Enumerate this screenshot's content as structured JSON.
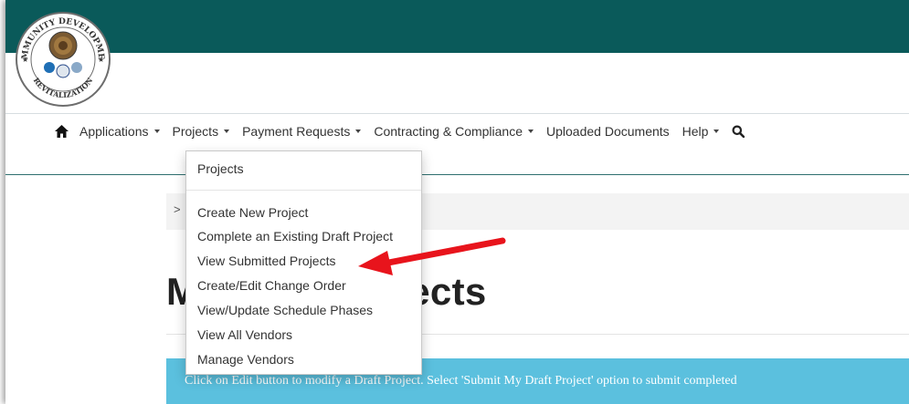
{
  "logo": {
    "ring_text_top": "COMMUNITY DEVELOPMENT",
    "ring_text_bottom": "REVITALIZATION",
    "colors": {
      "band": "#0a5a5a",
      "ring": "#6d6d6d",
      "seal": "#7a5a32"
    }
  },
  "nav": {
    "home_icon": "home-icon",
    "items": [
      {
        "label": "Applications",
        "has_caret": true
      },
      {
        "label": "Projects",
        "has_caret": true
      },
      {
        "label": "Payment Requests",
        "has_caret": true
      },
      {
        "label": "Contracting & Compliance",
        "has_caret": true
      },
      {
        "label": "Uploaded Documents",
        "has_caret": false
      },
      {
        "label": "Help",
        "has_caret": true
      }
    ],
    "search_icon": "search-icon"
  },
  "breadcrumb": {
    "char": ">"
  },
  "dropdown": {
    "header": "Projects",
    "items": [
      "Create New Project",
      "Complete an Existing Draft Project",
      "View Submitted Projects",
      "Create/Edit Change Order",
      "View/Update Schedule Phases",
      "View All Vendors",
      "Manage Vendors"
    ]
  },
  "page": {
    "title": "My Draft Projects",
    "info": "Click on Edit button to modify a Draft Project. Select 'Submit My Draft Project' option to submit completed"
  },
  "colors": {
    "navbar_border": "#2f6f6f",
    "info_bg": "#5bc0de",
    "arrow": "#e8141c"
  }
}
